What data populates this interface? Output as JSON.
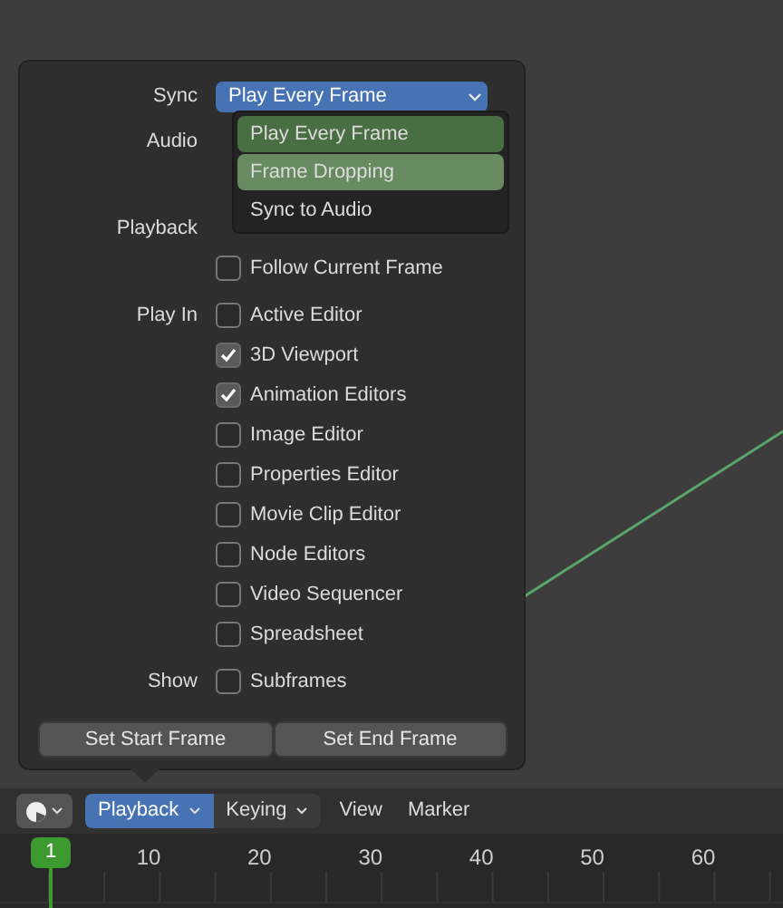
{
  "popover": {
    "sync": {
      "label": "Sync",
      "value": "Play Every Frame",
      "menu": [
        {
          "label": "Play Every Frame",
          "selected": true,
          "hovered": false
        },
        {
          "label": "Frame Dropping",
          "selected": false,
          "hovered": true
        },
        {
          "label": "Sync to Audio",
          "selected": false,
          "hovered": false
        }
      ]
    },
    "groups": [
      {
        "label": "Audio",
        "covered_by_menu": true
      },
      {
        "label": "Playback",
        "covered_by_menu": true,
        "options": [
          {
            "label": "Follow Current Frame",
            "checked": false
          }
        ]
      },
      {
        "label": "Play In",
        "covered_by_menu": false,
        "options": [
          {
            "label": "Active Editor",
            "checked": false
          },
          {
            "label": "3D Viewport",
            "checked": true
          },
          {
            "label": "Animation Editors",
            "checked": true
          },
          {
            "label": "Image Editor",
            "checked": false
          },
          {
            "label": "Properties Editor",
            "checked": false
          },
          {
            "label": "Movie Clip Editor",
            "checked": false
          },
          {
            "label": "Node Editors",
            "checked": false
          },
          {
            "label": "Video Sequencer",
            "checked": false
          },
          {
            "label": "Spreadsheet",
            "checked": false
          }
        ]
      },
      {
        "label": "Show",
        "covered_by_menu": false,
        "options": [
          {
            "label": "Subframes",
            "checked": false
          }
        ]
      }
    ],
    "buttons": [
      "Set Start Frame",
      "Set End Frame"
    ]
  },
  "header": {
    "menus": [
      {
        "label": "Playback",
        "kind": "dropdown",
        "selected": true
      },
      {
        "label": "Keying",
        "kind": "dropdown",
        "selected": false
      },
      {
        "label": "View",
        "kind": "plain",
        "selected": false
      },
      {
        "label": "Marker",
        "kind": "plain",
        "selected": false
      }
    ]
  },
  "timeline": {
    "current_frame": "1",
    "ticks": [
      "10",
      "20",
      "30",
      "40",
      "50",
      "60"
    ]
  }
}
